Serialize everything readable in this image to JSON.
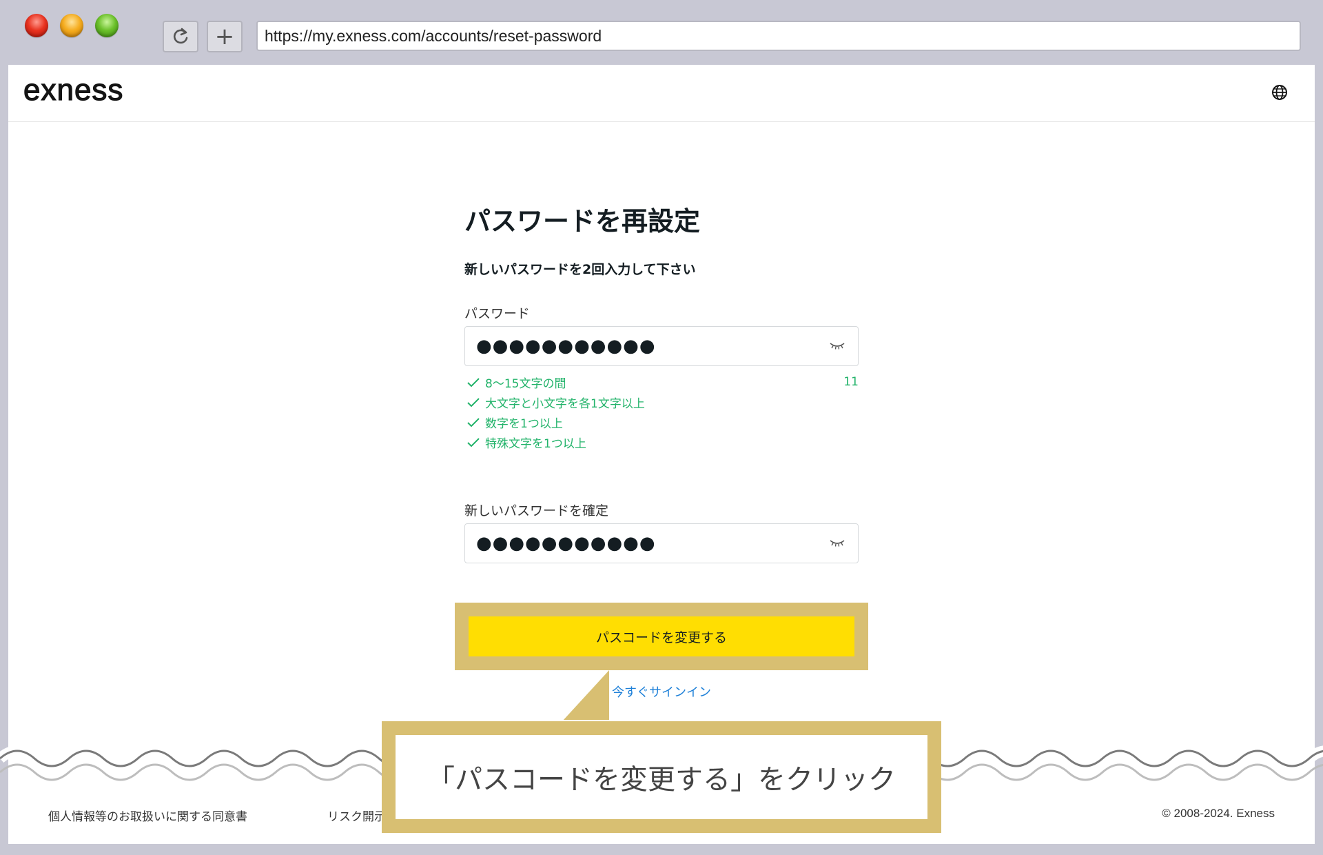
{
  "browser": {
    "url": "https://my.exness.com/accounts/reset-password",
    "new_tab_label": "+"
  },
  "header": {
    "logo_text": "exness",
    "language_icon": "globe-icon"
  },
  "form": {
    "title": "パスワードを再設定",
    "subtitle": "新しいパスワードを2回入力して下さい",
    "password_label": "パスワード",
    "password_value": "●●●●●●●●●●●",
    "char_count": "11",
    "rules": [
      "8～15文字の間",
      "大文字と小文字を各1文字以上",
      "数字を1つ以上",
      "特殊文字を1つ以上"
    ],
    "rule_color": "#22b36a",
    "confirm_label": "新しいパスワードを確定",
    "confirm_value": "●●●●●●●●●●●",
    "submit_label": "パスコードを変更する",
    "submit_color": "#ffde02",
    "signin_link": "今すぐサインイン",
    "link_color": "#1e80d8"
  },
  "footer": {
    "privacy": "個人情報等のお取扱いに関する同意書",
    "risk": "リスク開示",
    "copyright": "© 2008-2024. Exness"
  },
  "callout": {
    "text": "「パスコードを変更する」をクリック",
    "frame_color": "#d8bf72"
  }
}
